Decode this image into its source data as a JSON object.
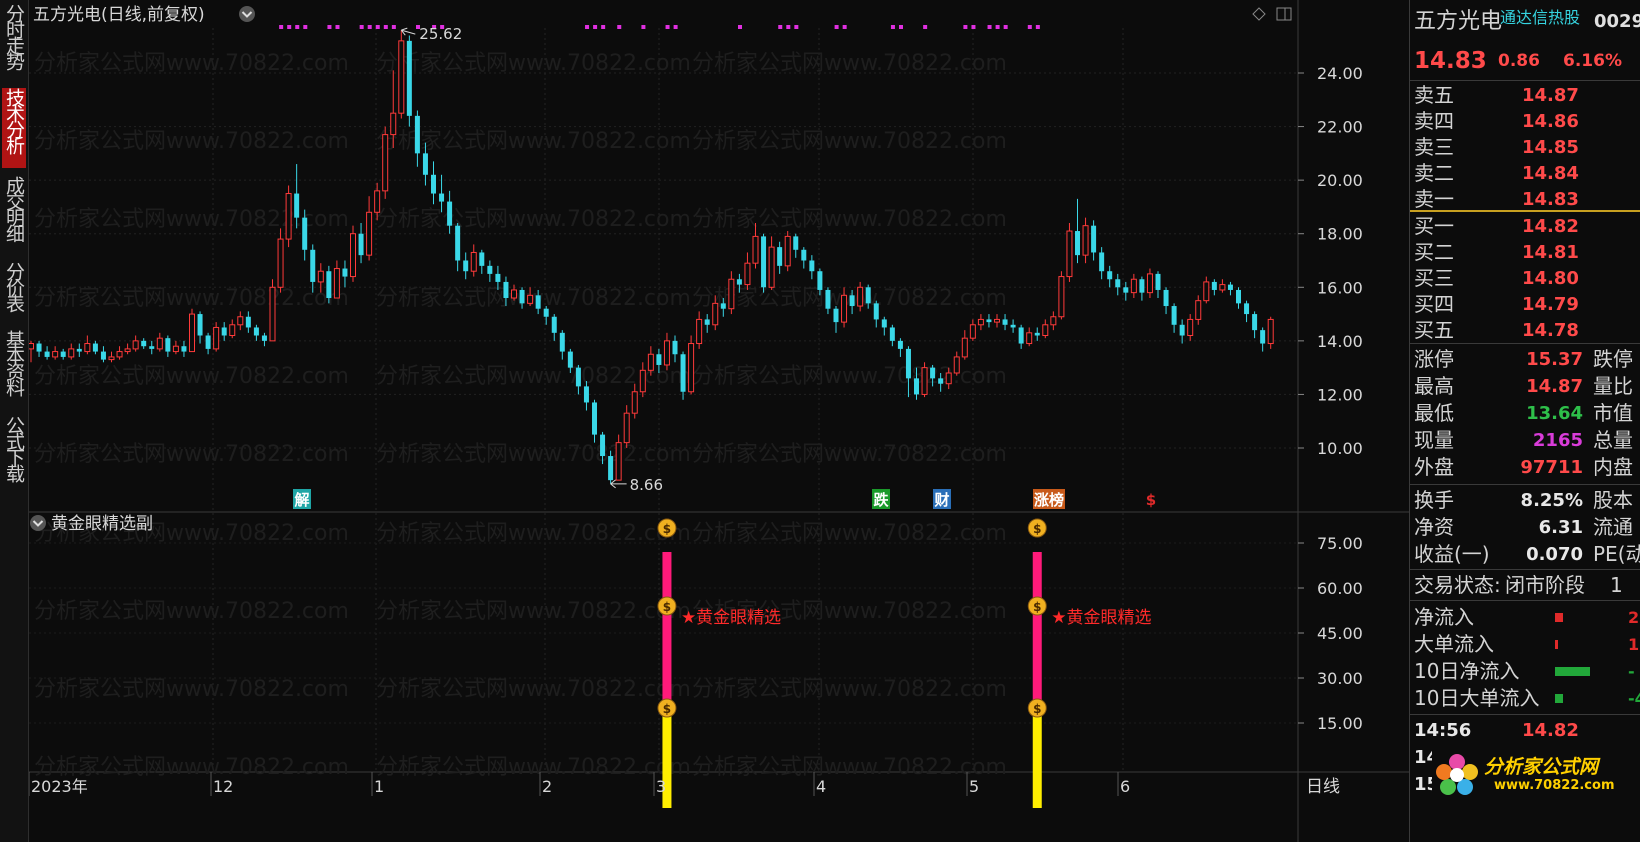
{
  "left_tabs": [
    "分时走势",
    "技术分析",
    "成交明细",
    "分价表",
    "基本资料",
    "公式下载"
  ],
  "chart_header": {
    "title": "五方光电(日线,前复权)",
    "max_label": "25.62",
    "min_label": "8.66"
  },
  "sub_header": {
    "title": "黄金眼精选副",
    "signal_text": "★黄金眼精选"
  },
  "price_axis": [
    "24.00",
    "22.00",
    "20.00",
    "18.00",
    "16.00",
    "14.00",
    "12.00",
    "10.00"
  ],
  "sub_axis": [
    "75.00",
    "60.00",
    "45.00",
    "30.00",
    "15.00"
  ],
  "x_axis": [
    "2023年",
    "12",
    "1",
    "2",
    "3",
    "4",
    "5",
    "6"
  ],
  "period_label": "日线",
  "event_tags": [
    {
      "label": "解",
      "color": "#1fa6a6"
    },
    {
      "label": "跌",
      "color": "#1a9a2a"
    },
    {
      "label": "财",
      "color": "#2a6fb8"
    },
    {
      "label": "涨榜",
      "color": "#c85a1a"
    },
    {
      "label": "$",
      "color": "#e02a2a"
    }
  ],
  "watermark": "分析家公式网www.70822.com",
  "panel": {
    "stock_name": "五方光电",
    "hot_tag": "通达信热股",
    "code_partial": "0029",
    "price": "14.83",
    "change": "0.86",
    "change_pct": "6.16%",
    "asks": [
      {
        "label": "卖五",
        "price": "14.87"
      },
      {
        "label": "卖四",
        "price": "14.86"
      },
      {
        "label": "卖三",
        "price": "14.85"
      },
      {
        "label": "卖二",
        "price": "14.84"
      },
      {
        "label": "卖一",
        "price": "14.83"
      }
    ],
    "bids": [
      {
        "label": "买一",
        "price": "14.82"
      },
      {
        "label": "买二",
        "price": "14.81"
      },
      {
        "label": "买三",
        "price": "14.80"
      },
      {
        "label": "买四",
        "price": "14.79"
      },
      {
        "label": "买五",
        "price": "14.78"
      }
    ],
    "stats": [
      {
        "label": "涨停",
        "value": "15.37",
        "right": "跌停",
        "color": "#ff4a4a"
      },
      {
        "label": "最高",
        "value": "14.87",
        "right": "量比",
        "color": "#ff4a4a"
      },
      {
        "label": "最低",
        "value": "13.64",
        "right": "市值",
        "color": "#2ec04a"
      },
      {
        "label": "现量",
        "value": "2165",
        "right": "总量",
        "color": "#d93cd9"
      },
      {
        "label": "外盘",
        "value": "97711",
        "right": "内盘",
        "color": "#ff4a4a"
      }
    ],
    "stats2": [
      {
        "label": "换手",
        "value": "8.25%",
        "right": "股本"
      },
      {
        "label": "净资",
        "value": "6.31",
        "right": "流通"
      },
      {
        "label": "收益(一)",
        "value": "0.070",
        "right": "PE(动"
      }
    ],
    "trade_state": {
      "label": "交易状态:",
      "value": "闭市阶段",
      "tail": "1"
    },
    "flows": [
      {
        "label": "净流入",
        "bar_color": "#e02a2a",
        "bar_frac": 0.15,
        "value": "2"
      },
      {
        "label": "大单流入",
        "bar_color": "#e02a2a",
        "bar_frac": 0.05,
        "value": "1"
      },
      {
        "label": "10日净流入",
        "bar_color": "#22a83a",
        "bar_frac": 0.7,
        "value": "-"
      },
      {
        "label": "10日大单流入",
        "bar_color": "#22a83a",
        "bar_frac": 0.15,
        "value": "-4"
      }
    ],
    "ticks": [
      {
        "time": "14:56",
        "price": "14.82"
      },
      {
        "time": "14",
        "price": ""
      },
      {
        "time": "15",
        "price": ""
      }
    ],
    "logo_text": "分析家公式网",
    "logo_url": "www.70822.com"
  },
  "chart_data": {
    "type": "candlestick",
    "y_range": [
      7.5,
      26.5
    ],
    "sub_range": [
      0,
      85
    ],
    "candles": [
      [
        13.7,
        13.9,
        13.2,
        14.0
      ],
      [
        13.9,
        13.6,
        13.4,
        14.0
      ],
      [
        13.6,
        13.4,
        13.3,
        13.8
      ],
      [
        13.4,
        13.6,
        13.3,
        13.8
      ],
      [
        13.6,
        13.4,
        13.3,
        13.7
      ],
      [
        13.4,
        13.7,
        13.3,
        13.9
      ],
      [
        13.7,
        13.6,
        13.4,
        13.9
      ],
      [
        13.6,
        13.9,
        13.5,
        14.2
      ],
      [
        13.9,
        13.6,
        13.5,
        14.0
      ],
      [
        13.6,
        13.3,
        13.2,
        13.8
      ],
      [
        13.3,
        13.4,
        13.2,
        13.6
      ],
      [
        13.4,
        13.6,
        13.3,
        13.8
      ],
      [
        13.6,
        13.7,
        13.5,
        13.9
      ],
      [
        13.7,
        14.0,
        13.6,
        14.2
      ],
      [
        14.0,
        13.8,
        13.7,
        14.1
      ],
      [
        13.8,
        13.7,
        13.5,
        14.0
      ],
      [
        13.7,
        14.1,
        13.6,
        14.3
      ],
      [
        14.1,
        13.6,
        13.4,
        14.2
      ],
      [
        13.6,
        13.8,
        13.5,
        14.0
      ],
      [
        13.8,
        13.6,
        13.4,
        14.0
      ],
      [
        13.6,
        15.0,
        13.6,
        15.2
      ],
      [
        15.0,
        14.2,
        13.9,
        15.1
      ],
      [
        14.2,
        13.7,
        13.5,
        14.3
      ],
      [
        13.7,
        14.5,
        13.6,
        14.7
      ],
      [
        14.5,
        14.2,
        14.0,
        14.7
      ],
      [
        14.2,
        14.6,
        14.1,
        14.8
      ],
      [
        14.6,
        14.9,
        14.4,
        15.1
      ],
      [
        14.9,
        14.5,
        14.3,
        15.1
      ],
      [
        14.5,
        14.2,
        14.0,
        14.6
      ],
      [
        14.2,
        14.0,
        13.8,
        14.3
      ],
      [
        14.0,
        16.0,
        14.0,
        16.3
      ],
      [
        16.0,
        17.8,
        15.8,
        18.2
      ],
      [
        17.8,
        19.5,
        17.5,
        19.8
      ],
      [
        19.5,
        18.6,
        18.2,
        20.6
      ],
      [
        18.6,
        17.4,
        17.0,
        18.9
      ],
      [
        17.4,
        16.2,
        15.8,
        17.6
      ],
      [
        16.2,
        16.6,
        15.8,
        16.9
      ],
      [
        16.6,
        15.6,
        15.4,
        16.8
      ],
      [
        15.6,
        16.7,
        15.6,
        17.0
      ],
      [
        16.7,
        16.4,
        16.0,
        17.0
      ],
      [
        16.4,
        18.0,
        16.2,
        18.3
      ],
      [
        18.0,
        17.2,
        16.9,
        18.4
      ],
      [
        17.2,
        18.8,
        17.0,
        19.4
      ],
      [
        18.8,
        19.6,
        18.5,
        19.9
      ],
      [
        19.6,
        21.7,
        19.3,
        22.0
      ],
      [
        21.7,
        22.5,
        21.2,
        24.1
      ],
      [
        22.5,
        25.2,
        22.3,
        25.6
      ],
      [
        25.2,
        22.4,
        22.0,
        25.4
      ],
      [
        22.4,
        21.0,
        20.5,
        22.6
      ],
      [
        21.0,
        20.2,
        19.8,
        21.4
      ],
      [
        20.2,
        19.5,
        19.1,
        20.7
      ],
      [
        19.5,
        19.2,
        18.8,
        20.2
      ],
      [
        19.2,
        18.3,
        18.0,
        19.6
      ],
      [
        18.3,
        17.0,
        16.6,
        18.4
      ],
      [
        17.0,
        16.6,
        16.3,
        17.3
      ],
      [
        16.6,
        17.3,
        16.4,
        17.6
      ],
      [
        17.3,
        16.8,
        16.5,
        17.4
      ],
      [
        16.8,
        16.5,
        16.2,
        17.0
      ],
      [
        16.5,
        16.2,
        15.9,
        16.8
      ],
      [
        16.2,
        15.6,
        15.3,
        16.4
      ],
      [
        15.6,
        15.9,
        15.5,
        16.1
      ],
      [
        15.9,
        15.4,
        15.2,
        16.0
      ],
      [
        15.4,
        15.7,
        15.3,
        16.0
      ],
      [
        15.7,
        15.2,
        15.0,
        15.9
      ],
      [
        15.2,
        14.9,
        14.6,
        15.3
      ],
      [
        14.9,
        14.3,
        14.0,
        15.0
      ],
      [
        14.3,
        13.6,
        13.3,
        14.4
      ],
      [
        13.6,
        13.0,
        12.8,
        13.7
      ],
      [
        13.0,
        12.3,
        12.0,
        13.1
      ],
      [
        12.3,
        11.7,
        11.4,
        12.5
      ],
      [
        11.7,
        10.5,
        10.2,
        11.8
      ],
      [
        10.5,
        9.7,
        9.4,
        10.6
      ],
      [
        9.7,
        8.8,
        8.66,
        9.9
      ],
      [
        8.8,
        10.2,
        8.8,
        10.5
      ],
      [
        10.2,
        11.3,
        10.0,
        11.6
      ],
      [
        11.3,
        12.1,
        11.1,
        12.4
      ],
      [
        12.1,
        12.9,
        11.9,
        13.2
      ],
      [
        12.9,
        13.5,
        12.7,
        13.8
      ],
      [
        13.5,
        13.1,
        12.8,
        13.7
      ],
      [
        13.1,
        14.0,
        12.9,
        14.3
      ],
      [
        14.0,
        13.5,
        13.2,
        14.2
      ],
      [
        13.5,
        12.1,
        11.8,
        13.6
      ],
      [
        12.1,
        13.9,
        12.0,
        14.2
      ],
      [
        13.9,
        14.8,
        13.7,
        15.1
      ],
      [
        14.8,
        14.6,
        14.3,
        15.0
      ],
      [
        14.6,
        15.4,
        14.4,
        15.7
      ],
      [
        15.4,
        15.2,
        14.9,
        15.6
      ],
      [
        15.2,
        16.3,
        15.0,
        16.6
      ],
      [
        16.3,
        16.1,
        15.8,
        16.5
      ],
      [
        16.1,
        16.9,
        15.9,
        17.3
      ],
      [
        16.9,
        17.9,
        16.7,
        18.4
      ],
      [
        17.9,
        16.0,
        15.8,
        18.0
      ],
      [
        16.0,
        17.5,
        15.9,
        17.9
      ],
      [
        17.5,
        16.8,
        16.5,
        17.7
      ],
      [
        16.8,
        17.9,
        16.6,
        18.1
      ],
      [
        17.9,
        17.4,
        17.1,
        18.0
      ],
      [
        17.4,
        17.0,
        16.7,
        17.5
      ],
      [
        17.0,
        16.6,
        16.3,
        17.2
      ],
      [
        16.6,
        15.9,
        15.7,
        16.7
      ],
      [
        15.9,
        15.2,
        15.0,
        16.0
      ],
      [
        15.2,
        14.7,
        14.3,
        15.3
      ],
      [
        14.7,
        15.7,
        14.5,
        16.0
      ],
      [
        15.7,
        15.3,
        15.0,
        15.9
      ],
      [
        15.3,
        16.0,
        15.1,
        16.2
      ],
      [
        16.0,
        15.4,
        15.2,
        16.1
      ],
      [
        15.4,
        14.8,
        14.5,
        15.5
      ],
      [
        14.8,
        14.5,
        14.2,
        14.9
      ],
      [
        14.5,
        14.0,
        13.8,
        14.6
      ],
      [
        14.0,
        13.7,
        13.4,
        14.1
      ],
      [
        13.7,
        12.6,
        11.9,
        13.8
      ],
      [
        12.6,
        12.0,
        11.8,
        13.0
      ],
      [
        12.0,
        13.0,
        11.9,
        13.2
      ],
      [
        13.0,
        12.6,
        12.3,
        13.1
      ],
      [
        12.6,
        12.4,
        12.1,
        12.8
      ],
      [
        12.4,
        12.8,
        12.2,
        13.0
      ],
      [
        12.8,
        13.4,
        12.7,
        13.6
      ],
      [
        13.4,
        14.1,
        13.3,
        14.4
      ],
      [
        14.1,
        14.6,
        14.0,
        14.8
      ],
      [
        14.6,
        14.8,
        14.4,
        15.0
      ],
      [
        14.8,
        14.7,
        14.5,
        15.0
      ],
      [
        14.7,
        14.8,
        14.5,
        15.0
      ],
      [
        14.8,
        14.6,
        14.4,
        15.0
      ],
      [
        14.6,
        14.5,
        14.3,
        14.8
      ],
      [
        14.5,
        13.9,
        13.7,
        14.6
      ],
      [
        13.9,
        14.3,
        13.8,
        14.5
      ],
      [
        14.3,
        14.2,
        14.0,
        14.5
      ],
      [
        14.2,
        14.6,
        14.1,
        14.8
      ],
      [
        14.6,
        14.9,
        14.4,
        15.1
      ],
      [
        14.9,
        16.4,
        14.8,
        16.6
      ],
      [
        16.4,
        18.1,
        16.2,
        18.4
      ],
      [
        18.1,
        17.2,
        16.9,
        19.3
      ],
      [
        17.2,
        18.3,
        16.9,
        18.6
      ],
      [
        18.3,
        17.3,
        17.0,
        18.5
      ],
      [
        17.3,
        16.6,
        16.3,
        17.5
      ],
      [
        16.6,
        16.3,
        16.0,
        16.8
      ],
      [
        16.3,
        16.0,
        15.7,
        16.5
      ],
      [
        16.0,
        15.8,
        15.5,
        16.2
      ],
      [
        15.8,
        16.3,
        15.6,
        16.5
      ],
      [
        16.3,
        15.8,
        15.5,
        16.4
      ],
      [
        15.8,
        16.5,
        15.6,
        16.7
      ],
      [
        16.5,
        15.9,
        15.6,
        16.6
      ],
      [
        15.9,
        15.3,
        15.0,
        16.0
      ],
      [
        15.3,
        14.6,
        14.3,
        15.4
      ],
      [
        14.6,
        14.2,
        13.9,
        14.8
      ],
      [
        14.2,
        14.8,
        14.0,
        15.0
      ],
      [
        14.8,
        15.5,
        14.6,
        15.7
      ],
      [
        15.5,
        16.2,
        15.4,
        16.4
      ],
      [
        16.2,
        15.9,
        15.7,
        16.3
      ],
      [
        15.9,
        16.1,
        15.8,
        16.3
      ],
      [
        16.1,
        15.9,
        15.7,
        16.2
      ],
      [
        15.9,
        15.4,
        15.2,
        16.0
      ],
      [
        15.4,
        15.0,
        14.7,
        15.5
      ],
      [
        15.0,
        14.4,
        14.1,
        15.1
      ],
      [
        14.4,
        13.9,
        13.6,
        14.5
      ],
      [
        13.9,
        14.8,
        13.7,
        14.9
      ]
    ],
    "signals": [
      {
        "candle_index": 79,
        "yellow": [
          0,
          20
        ],
        "red": [
          20,
          72
        ]
      },
      {
        "candle_index": 125,
        "yellow": [
          0,
          20
        ],
        "red": [
          20,
          72
        ]
      }
    ],
    "top_marker_indices": [
      3,
      4,
      5,
      6,
      9,
      10,
      13,
      14,
      15,
      16,
      17,
      20,
      22,
      23,
      41,
      42,
      43,
      45,
      48,
      51,
      52,
      60,
      65,
      66,
      67,
      72,
      73,
      79,
      80,
      83,
      88,
      89,
      91,
      92,
      93,
      96,
      97
    ]
  }
}
